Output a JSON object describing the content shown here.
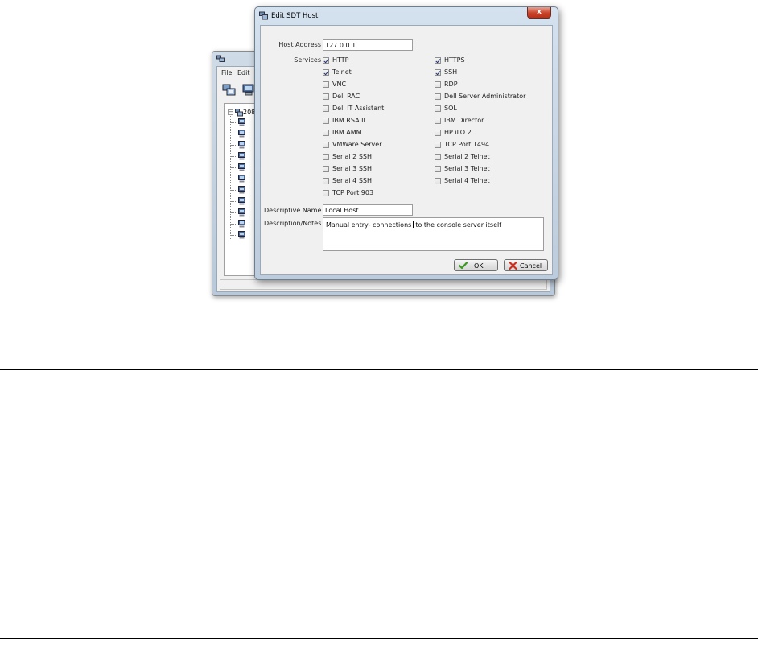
{
  "background_window": {
    "menu": [
      "File",
      "Edit"
    ],
    "tree_root_label": "208"
  },
  "dialog": {
    "title": "Edit SDT Host",
    "close_glyph": "x",
    "host_address_label": "Host Address",
    "host_address_value": "127.0.0.1",
    "services_label": "Services",
    "services_left": [
      {
        "label": "HTTP",
        "checked": true
      },
      {
        "label": "Telnet",
        "checked": true
      },
      {
        "label": "VNC",
        "checked": false
      },
      {
        "label": "Dell RAC",
        "checked": false
      },
      {
        "label": "Dell IT Assistant",
        "checked": false
      },
      {
        "label": "IBM RSA II",
        "checked": false
      },
      {
        "label": "IBM AMM",
        "checked": false
      },
      {
        "label": "VMWare Server",
        "checked": false
      },
      {
        "label": "Serial 2 SSH",
        "checked": false
      },
      {
        "label": "Serial 3 SSH",
        "checked": false
      },
      {
        "label": "Serial 4 SSH",
        "checked": false
      },
      {
        "label": "TCP Port 903",
        "checked": false
      }
    ],
    "services_right": [
      {
        "label": "HTTPS",
        "checked": true
      },
      {
        "label": "SSH",
        "checked": true
      },
      {
        "label": "RDP",
        "checked": false
      },
      {
        "label": "Dell Server Administrator",
        "checked": false
      },
      {
        "label": "SOL",
        "checked": false
      },
      {
        "label": "IBM Director",
        "checked": false
      },
      {
        "label": "HP iLO 2",
        "checked": false
      },
      {
        "label": "TCP Port 1494",
        "checked": false
      },
      {
        "label": "Serial 2 Telnet",
        "checked": false
      },
      {
        "label": "Serial 3 Telnet",
        "checked": false
      },
      {
        "label": "Serial 4 Telnet",
        "checked": false
      }
    ],
    "descriptive_name_label": "Descriptive Name",
    "descriptive_name_value": "Local Host",
    "notes_label": "Description/Notes",
    "notes_before_caret": "Manual entry- connections",
    "notes_after_caret": "to the console server itself",
    "ok_label": "OK",
    "cancel_label": "Cancel"
  }
}
